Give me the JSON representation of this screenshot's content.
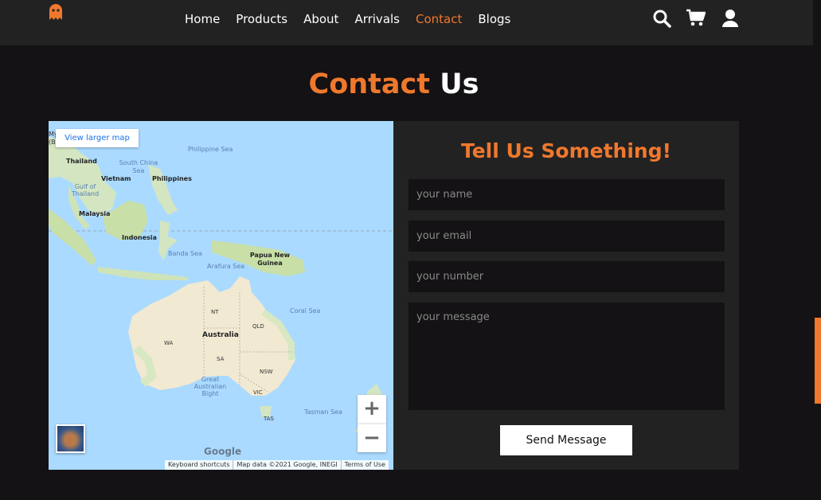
{
  "nav": {
    "items": [
      {
        "label": "Home"
      },
      {
        "label": "Products"
      },
      {
        "label": "About"
      },
      {
        "label": "Arrivals"
      },
      {
        "label": "Contact",
        "active": true
      },
      {
        "label": "Blogs"
      }
    ],
    "icons": [
      "search-icon",
      "cart-icon",
      "user-icon"
    ],
    "logo_icon": "ghost-icon"
  },
  "title": {
    "part1": "Contact",
    "part2": "Us"
  },
  "map": {
    "view_larger": "View larger map",
    "zoom_in": "+",
    "zoom_out": "−",
    "google": "Google",
    "keyboard": "Keyboard shortcuts",
    "map_data": "Map data ©2021 Google, INEGI",
    "terms": "Terms of Use",
    "labels": {
      "myanmar": "My",
      "bangkok": "(Ba",
      "thailand": "Thailand",
      "philippine_sea": "Philippine Sea",
      "south_china_sea": "South China Sea",
      "vietnam": "Vietnam",
      "philippines": "Philippines",
      "gulf_thailand": "Gulf of Thailand",
      "malaysia": "Malaysia",
      "indonesia": "Indonesia",
      "banda_sea": "Banda Sea",
      "png": "Papua New Guinea",
      "arafura_sea": "Arafura Sea",
      "coral_sea": "Coral Sea",
      "nt": "NT",
      "qld": "QLD",
      "wa": "WA",
      "australia": "Australia",
      "sa": "SA",
      "nsw": "NSW",
      "great_bight": "Great Australian Bight",
      "vic": "VIC",
      "tas": "TAS",
      "tasman_sea": "Tasman Sea"
    }
  },
  "form": {
    "title": "Tell Us Something!",
    "name_placeholder": "your name",
    "email_placeholder": "your email",
    "number_placeholder": "your number",
    "message_placeholder": "your message",
    "send_label": "Send Message"
  },
  "colors": {
    "accent": "#f0782d",
    "background": "#141214",
    "panel": "#222222"
  }
}
